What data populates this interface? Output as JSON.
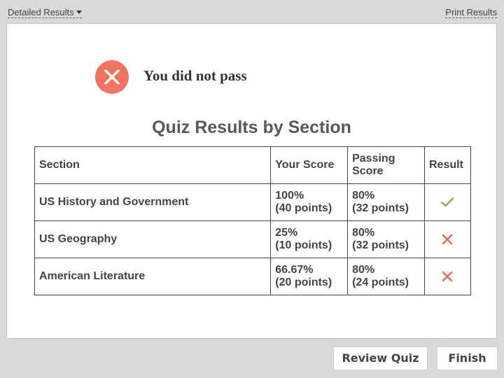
{
  "header": {
    "detailed_results_label": "Detailed Results",
    "print_results_label": "Print Results"
  },
  "status": {
    "message": "You did not pass",
    "icon": "fail-x-circle-icon",
    "icon_color": "#f07460"
  },
  "results": {
    "title": "Quiz Results by Section",
    "columns": [
      "Section",
      "Your Score",
      "Passing Score",
      "Result"
    ],
    "rows": [
      {
        "section": "US History and Government",
        "your_score_pct": "100%",
        "your_score_points": "(40 points)",
        "passing_pct": "80%",
        "passing_points": "(32 points)",
        "result": "pass"
      },
      {
        "section": "US Geography",
        "your_score_pct": "25%",
        "your_score_points": "(10 points)",
        "passing_pct": "80%",
        "passing_points": "(32 points)",
        "result": "fail"
      },
      {
        "section": "American Literature",
        "your_score_pct": "66.67%",
        "your_score_points": "(20 points)",
        "passing_pct": "80%",
        "passing_points": "(24 points)",
        "result": "fail"
      }
    ]
  },
  "colors": {
    "pass": "#7bb54e",
    "fail": "#ea6a55"
  },
  "buttons": {
    "review_quiz": "Review Quiz",
    "finish": "Finish"
  }
}
